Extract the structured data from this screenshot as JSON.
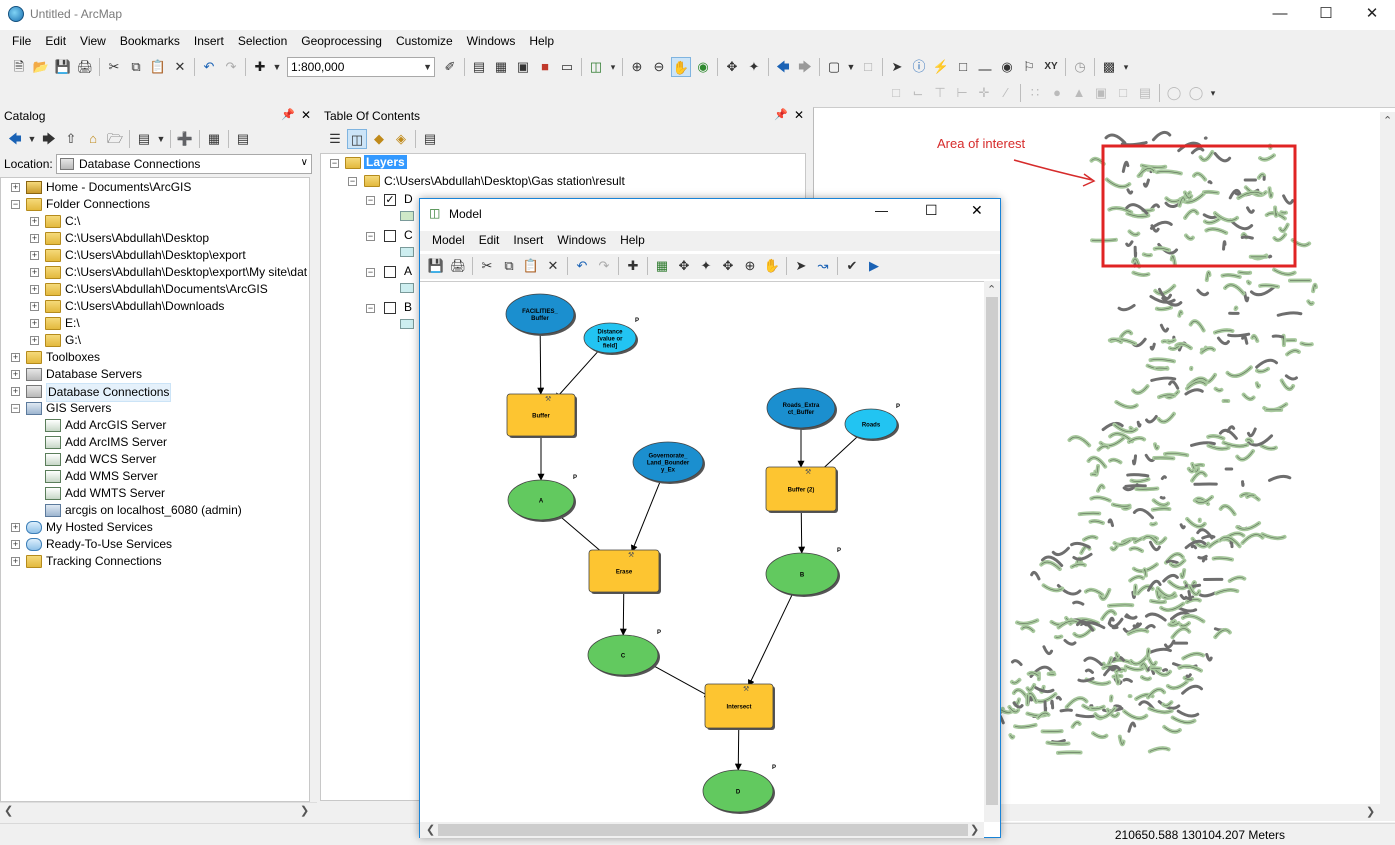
{
  "window": {
    "title": "Untitled - ArcMap"
  },
  "menu": [
    "File",
    "Edit",
    "View",
    "Bookmarks",
    "Insert",
    "Selection",
    "Geoprocessing",
    "Customize",
    "Windows",
    "Help"
  ],
  "toolbar": {
    "scale": "1:800,000"
  },
  "catalog": {
    "title": "Catalog",
    "location_label": "Location:",
    "location_value": "Database Connections",
    "items": [
      {
        "label": "Home - Documents\\ArcGIS",
        "icon": "home-folder-icon",
        "level": 0,
        "expander": "+"
      },
      {
        "label": "Folder Connections",
        "icon": "folder-icon",
        "level": 0,
        "expander": "−"
      },
      {
        "label": "C:\\",
        "icon": "folder-icon",
        "level": 1,
        "expander": "+"
      },
      {
        "label": "C:\\Users\\Abdullah\\Desktop",
        "icon": "folder-icon",
        "level": 1,
        "expander": "+"
      },
      {
        "label": "C:\\Users\\Abdullah\\Desktop\\export",
        "icon": "folder-icon",
        "level": 1,
        "expander": "+"
      },
      {
        "label": "C:\\Users\\Abdullah\\Desktop\\export\\My site\\dat",
        "icon": "folder-icon",
        "level": 1,
        "expander": "+"
      },
      {
        "label": "C:\\Users\\Abdullah\\Documents\\ArcGIS",
        "icon": "folder-icon",
        "level": 1,
        "expander": "+"
      },
      {
        "label": "C:\\Users\\Abdullah\\Downloads",
        "icon": "folder-icon",
        "level": 1,
        "expander": "+"
      },
      {
        "label": "E:\\",
        "icon": "folder-icon",
        "level": 1,
        "expander": "+"
      },
      {
        "label": "G:\\",
        "icon": "folder-icon",
        "level": 1,
        "expander": "+"
      },
      {
        "label": "Toolboxes",
        "icon": "toolbox-icon",
        "level": 0,
        "expander": "+"
      },
      {
        "label": "Database Servers",
        "icon": "database-server-icon",
        "level": 0,
        "expander": "+"
      },
      {
        "label": "Database Connections",
        "icon": "database-icon",
        "level": 0,
        "expander": "+",
        "selected": true
      },
      {
        "label": "GIS Servers",
        "icon": "gis-server-icon",
        "level": 0,
        "expander": "−"
      },
      {
        "label": "Add ArcGIS Server",
        "icon": "add-server-icon",
        "level": 1,
        "expander": ""
      },
      {
        "label": "Add ArcIMS Server",
        "icon": "add-server-icon",
        "level": 1,
        "expander": ""
      },
      {
        "label": "Add WCS Server",
        "icon": "add-server-icon",
        "level": 1,
        "expander": ""
      },
      {
        "label": "Add WMS Server",
        "icon": "add-server-icon",
        "level": 1,
        "expander": ""
      },
      {
        "label": "Add WMTS Server",
        "icon": "add-server-icon",
        "level": 1,
        "expander": ""
      },
      {
        "label": "arcgis on localhost_6080 (admin)",
        "icon": "server-connection-icon",
        "level": 1,
        "expander": ""
      },
      {
        "label": "My Hosted Services",
        "icon": "cloud-icon",
        "level": 0,
        "expander": "+"
      },
      {
        "label": "Ready-To-Use Services",
        "icon": "cloud-icon",
        "level": 0,
        "expander": "+"
      },
      {
        "label": "Tracking Connections",
        "icon": "tracking-icon",
        "level": 0,
        "expander": "+"
      }
    ]
  },
  "toc": {
    "title": "Table Of Contents",
    "root": "Layers",
    "group": "C:\\Users\\Abdullah\\Desktop\\Gas station\\result",
    "layers": [
      {
        "name": "D",
        "checked": true,
        "swatch": "#cfe8c8"
      },
      {
        "name": "C",
        "checked": false,
        "swatch": "#cdeef0"
      },
      {
        "name": "A",
        "checked": false,
        "swatch": "#cdeef0"
      },
      {
        "name": "B",
        "checked": false,
        "swatch": "#cdeef0"
      }
    ]
  },
  "map": {
    "annotation": "Area of interest"
  },
  "model": {
    "title": "Model",
    "menu": [
      "Model",
      "Edit",
      "Insert",
      "Windows",
      "Help"
    ],
    "nodes": [
      {
        "id": "facilities",
        "label": "FACILITIES_Buffer",
        "label_lines": [
          "FACILITIES_",
          "Buffer"
        ],
        "shape": "ellipse",
        "color": "#1b8fcf",
        "p": false
      },
      {
        "id": "distance",
        "label": "Distance [value or field]",
        "label_lines": [
          "Distance",
          "[value or",
          "field]"
        ],
        "shape": "ellipse",
        "color": "#22c4f2",
        "p": true
      },
      {
        "id": "buffer",
        "label": "Buffer",
        "label_lines": [
          "Buffer"
        ],
        "shape": "rect",
        "color": "#fdc531",
        "p": false
      },
      {
        "id": "a",
        "label": "A",
        "label_lines": [
          "A"
        ],
        "shape": "ellipse",
        "color": "#62c95f",
        "p": true
      },
      {
        "id": "governorate",
        "label": "Governorate_Land_Boundary_Ex",
        "label_lines": [
          "Governorate_",
          "Land_Bounder",
          "y_Ex"
        ],
        "shape": "ellipse",
        "color": "#1b8fcf",
        "p": false
      },
      {
        "id": "erase",
        "label": "Erase",
        "label_lines": [
          "Erase"
        ],
        "shape": "rect",
        "color": "#fdc531",
        "p": false
      },
      {
        "id": "c",
        "label": "C",
        "label_lines": [
          "C"
        ],
        "shape": "ellipse",
        "color": "#62c95f",
        "p": true
      },
      {
        "id": "roads_extract",
        "label": "Roads_Extract_Buffer",
        "label_lines": [
          "Roads_Extra",
          "ct_Buffer"
        ],
        "shape": "ellipse",
        "color": "#1b8fcf",
        "p": false
      },
      {
        "id": "roads",
        "label": "Roads",
        "label_lines": [
          "Roads"
        ],
        "shape": "ellipse",
        "color": "#22c4f2",
        "p": true
      },
      {
        "id": "buffer2",
        "label": "Buffer (2)",
        "label_lines": [
          "Buffer (2)"
        ],
        "shape": "rect",
        "color": "#fdc531",
        "p": false
      },
      {
        "id": "b",
        "label": "B",
        "label_lines": [
          "B"
        ],
        "shape": "ellipse",
        "color": "#62c95f",
        "p": true
      },
      {
        "id": "intersect",
        "label": "Intersect",
        "label_lines": [
          "Intersect"
        ],
        "shape": "rect",
        "color": "#fdc531",
        "p": false
      },
      {
        "id": "d",
        "label": "D",
        "label_lines": [
          "D"
        ],
        "shape": "ellipse",
        "color": "#62c95f",
        "p": true
      }
    ],
    "edges": [
      [
        "facilities",
        "buffer"
      ],
      [
        "distance",
        "buffer"
      ],
      [
        "buffer",
        "a"
      ],
      [
        "a",
        "erase"
      ],
      [
        "governorate",
        "erase"
      ],
      [
        "erase",
        "c"
      ],
      [
        "roads_extract",
        "buffer2"
      ],
      [
        "roads",
        "buffer2"
      ],
      [
        "buffer2",
        "b"
      ],
      [
        "c",
        "intersect"
      ],
      [
        "b",
        "intersect"
      ],
      [
        "intersect",
        "d"
      ]
    ],
    "p_marker": "P"
  },
  "status": {
    "coords": "210650.588  130104.207 Meters"
  }
}
